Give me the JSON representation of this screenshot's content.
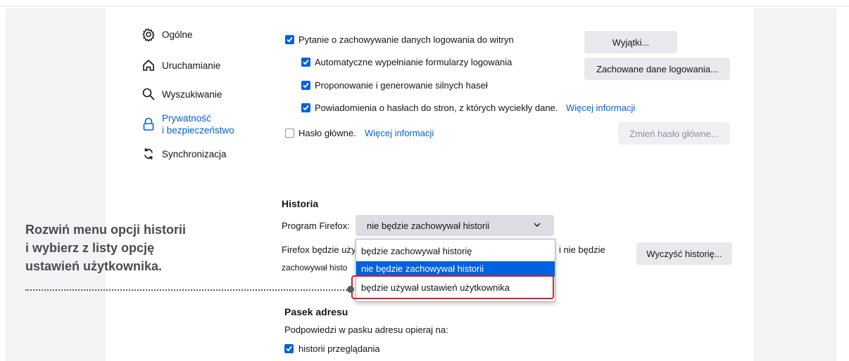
{
  "sidebar": {
    "items": [
      {
        "label": "Ogólne",
        "icon": "gear-icon"
      },
      {
        "label": "Uruchamianie",
        "icon": "home-icon"
      },
      {
        "label": "Wyszukiwanie",
        "icon": "search-icon"
      },
      {
        "label_line1": "Prywatność",
        "label_line2": "i bezpieczeństwo",
        "icon": "lock-icon",
        "active": true
      },
      {
        "label": "Synchronizacja",
        "icon": "sync-icon"
      }
    ]
  },
  "logins": {
    "ask_save": {
      "label": "Pytanie o zachowywanie danych logowania do witryn",
      "checked": true
    },
    "autofill": {
      "label": "Automatyczne wypełnianie formularzy logowania",
      "checked": true
    },
    "suggest_strong": {
      "label": "Proponowanie i generowanie silnych haseł",
      "checked": true
    },
    "breach_alerts": {
      "label": "Powiadomienia o hasłach do stron, z których wyciekły dane.",
      "link": "Więcej informacji",
      "checked": true
    },
    "master_password": {
      "label": "Hasło główne.",
      "link": "Więcej informacji",
      "checked": false
    },
    "exceptions_button": "Wyjątki...",
    "saved_logins_button": "Zachowane dane logowania...",
    "change_master_button": "Zmień hasło główne..."
  },
  "history": {
    "heading": "Historia",
    "program_label": "Program Firefox:",
    "selected": "nie będzie zachowywał historii",
    "desc_line1_left": "Firefox będzie uży",
    "desc_line1_right": "i nie będzie",
    "desc_line2_left": "zachowywał histo",
    "clear_button": "Wyczyść historię...",
    "options": [
      "będzie zachowywał historię",
      "nie będzie zachowywał historii",
      "będzie używał ustawień użytkownika"
    ]
  },
  "address_bar": {
    "heading": "Pasek adresu",
    "desc": "Podpowiedzi w pasku adresu opieraj na:",
    "browsing_history": {
      "label": "historii przeglądania",
      "checked": true
    }
  },
  "callout": {
    "line1": "Rozwiń menu opcji historii",
    "line2": "i wybierz z listy opcję",
    "line3": "ustawień użytkownika."
  },
  "colors": {
    "accent": "#0061e0",
    "highlight": "#d0222d",
    "callout_text": "#4a4a52"
  }
}
